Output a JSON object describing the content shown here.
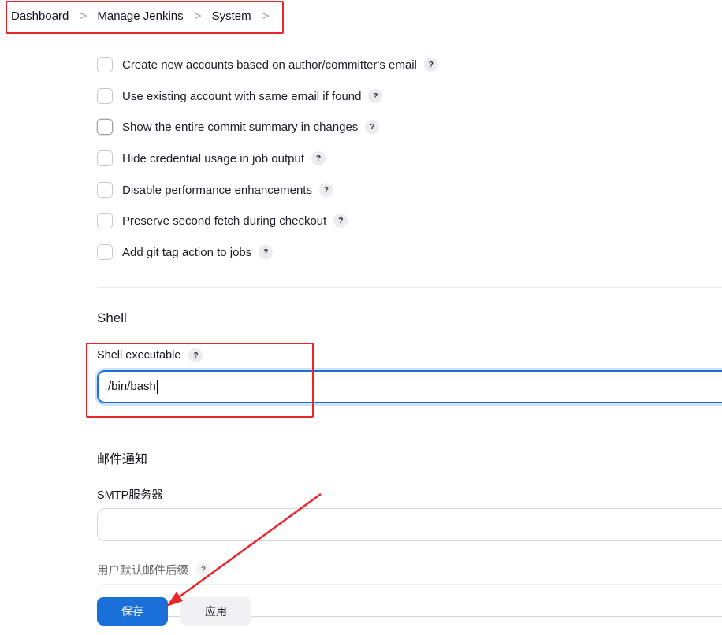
{
  "breadcrumb": {
    "items": [
      "Dashboard",
      "Manage Jenkins",
      "System"
    ],
    "separator": ">"
  },
  "git_options": [
    {
      "label": "Create new accounts based on author/committer's email",
      "checked": false
    },
    {
      "label": "Use existing account with same email if found",
      "checked": false
    },
    {
      "label": "Show the entire commit summary in changes",
      "checked": false
    },
    {
      "label": "Hide credential usage in job output",
      "checked": false
    },
    {
      "label": "Disable performance enhancements",
      "checked": false
    },
    {
      "label": "Preserve second fetch during checkout",
      "checked": false
    },
    {
      "label": "Add git tag action to jobs",
      "checked": false
    }
  ],
  "help_glyph": "?",
  "shell": {
    "title": "Shell",
    "executable_label": "Shell executable",
    "executable_value": "/bin/bash"
  },
  "email": {
    "title": "邮件通知",
    "smtp_label": "SMTP服务器",
    "smtp_value": "",
    "suffix_label": "用户默认邮件后缀"
  },
  "actions": {
    "save_label": "保存",
    "apply_label": "应用"
  },
  "colors": {
    "accent": "#1a6fd8",
    "annotation": "#e8262b"
  }
}
